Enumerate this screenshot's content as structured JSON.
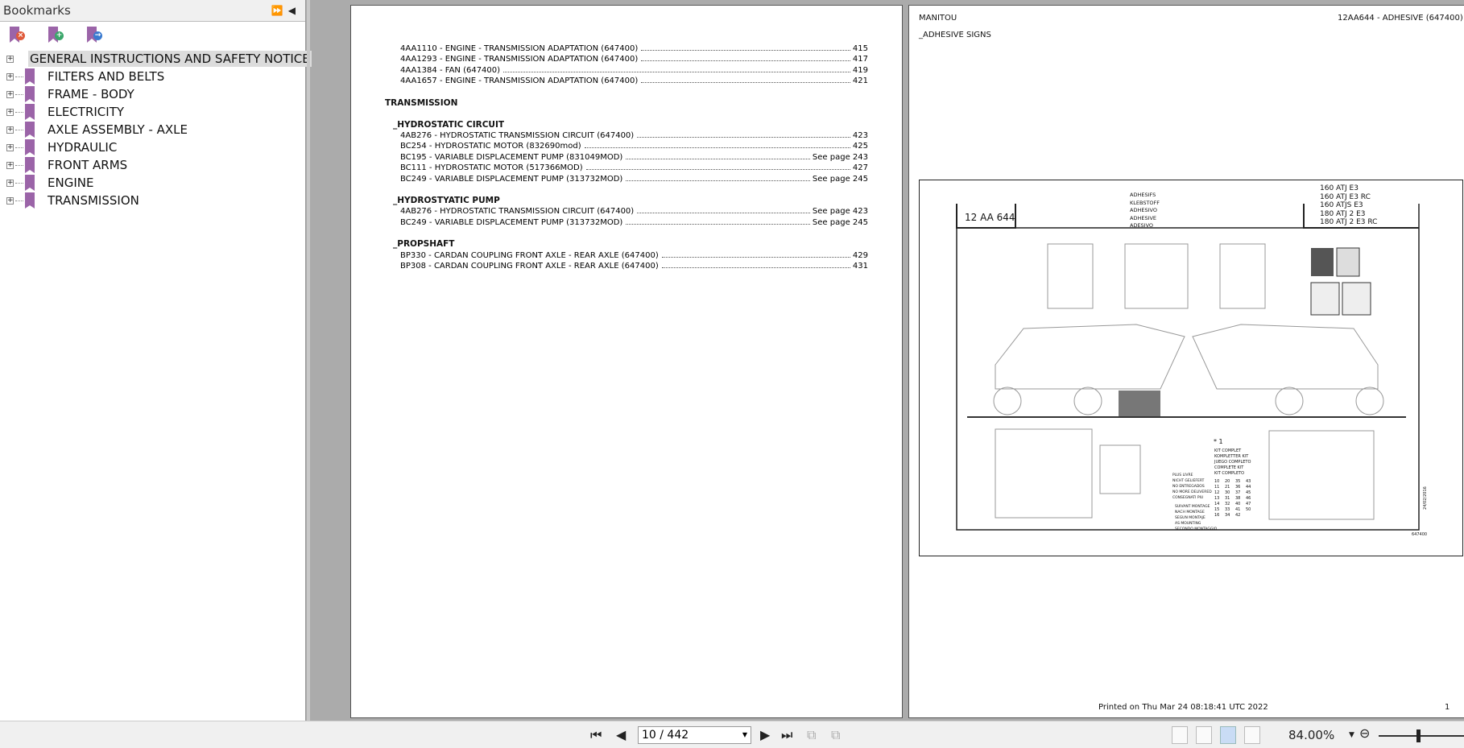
{
  "sidebar": {
    "title": "Bookmarks",
    "items": [
      {
        "label": "GENERAL INSTRUCTIONS AND SAFETY NOTICE",
        "selected": true
      },
      {
        "label": "FILTERS AND BELTS"
      },
      {
        "label": "FRAME - BODY"
      },
      {
        "label": "ELECTRICITY"
      },
      {
        "label": "AXLE ASSEMBLY - AXLE"
      },
      {
        "label": "HYDRAULIC"
      },
      {
        "label": "FRONT ARMS"
      },
      {
        "label": "ENGINE"
      },
      {
        "label": "TRANSMISSION"
      }
    ]
  },
  "left_page": {
    "top_rows": [
      {
        "t": "4AA1110 - ENGINE - TRANSMISSION ADAPTATION (647400)",
        "p": "415"
      },
      {
        "t": "4AA1293 - ENGINE - TRANSMISSION ADAPTATION (647400)",
        "p": "417"
      },
      {
        "t": "4AA1384 - FAN (647400)",
        "p": "419"
      },
      {
        "t": "4AA1657 - ENGINE - TRANSMISSION ADAPTATION (647400)",
        "p": "421"
      }
    ],
    "section": "TRANSMISSION",
    "groups": [
      {
        "title": "_HYDROSTATIC CIRCUIT",
        "rows": [
          {
            "t": "4AB276 - HYDROSTATIC TRANSMISSION CIRCUIT (647400)",
            "p": "423"
          },
          {
            "t": "BC254 - HYDROSTATIC MOTOR (832690mod)",
            "p": "425"
          },
          {
            "t": "BC195 - VARIABLE DISPLACEMENT PUMP (831049MOD)",
            "p": "See page 243"
          },
          {
            "t": "BC111 - HYDROSTATIC MOTOR (517366MOD)",
            "p": "427"
          },
          {
            "t": "BC249 - VARIABLE DISPLACEMENT PUMP (313732MOD)",
            "p": "See page 245"
          }
        ]
      },
      {
        "title": "_HYDROSTYATIC PUMP",
        "rows": [
          {
            "t": "4AB276 - HYDROSTATIC TRANSMISSION CIRCUIT (647400)",
            "p": "See page 423"
          },
          {
            "t": "BC249 - VARIABLE DISPLACEMENT PUMP (313732MOD)",
            "p": "See page 245"
          }
        ]
      },
      {
        "title": "_PROPSHAFT",
        "rows": [
          {
            "t": "BP330 - CARDAN COUPLING FRONT AXLE - REAR AXLE (647400)",
            "p": "429"
          },
          {
            "t": "BP308 - CARDAN COUPLING FRONT AXLE - REAR AXLE (647400)",
            "p": "431"
          }
        ]
      }
    ]
  },
  "right_page": {
    "header_left": "MANITOU",
    "header_right": "12AA644 - ADHESIVE (647400)",
    "subtitle": "_ADHESIVE SIGNS",
    "diagram": {
      "code": "12 AA 644",
      "languages": [
        "ADHESIFS",
        "KLEBSTOFF",
        "ADHESIVO",
        "ADHESIVE",
        "ADESIVO"
      ],
      "models": [
        "160 ATJ E3",
        "160 ATJ E3 RC",
        "160 ATJS E3",
        "180 ATJ 2 E3",
        "180 ATJ 2 E3 RC"
      ],
      "kit_ref": "* 1",
      "kit": [
        "KIT COMPLET",
        "KOMPLETTER KIT",
        "JUEGO COMPLETO",
        "COMPLETE KIT",
        "KIT COMPLETO"
      ],
      "kit_numbers": [
        "10",
        "11",
        "12",
        "13",
        "14",
        "15",
        "16",
        "20",
        "21",
        "30",
        "31",
        "32",
        "33",
        "34",
        "35",
        "36",
        "37",
        "38",
        "40",
        "41",
        "42",
        "43",
        "44",
        "45",
        "46",
        "47",
        "50"
      ],
      "not_supplied": [
        "PLUS LIVRE",
        "NICHT GELIEFERT",
        "NO ENTREGADOS",
        "NO MORE DELIVERED",
        "CONSEGNATI PIU"
      ],
      "as_mounting": [
        "SUIVANT MONTAGE",
        "NACH MONTAGE",
        "SEGUN MONTAJE",
        "AS MOUNTING",
        "SECONDO MONTAGGIO"
      ],
      "date": "24/02/2016",
      "ref": "647400"
    },
    "footer": "Printed on  Thu Mar 24 08:18:41 UTC 2022",
    "page_num": "1"
  },
  "toolbar": {
    "page": "10 / 442",
    "zoom": "84.00%"
  }
}
